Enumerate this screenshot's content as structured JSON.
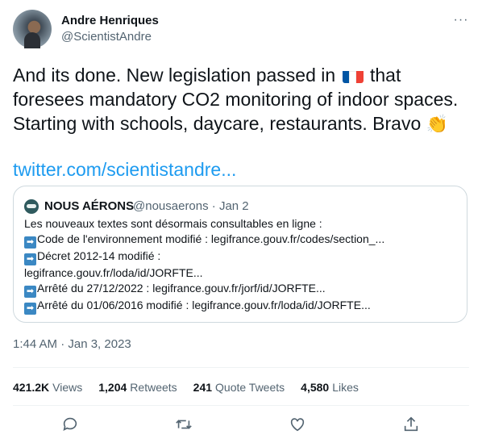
{
  "author": {
    "name": "Andre Henriques",
    "handle": "@ScientistAndre"
  },
  "more_label": "···",
  "tweet": {
    "line1_before": "And its done. New legislation passed in ",
    "line1_after": " that",
    "line2": "foresees mandatory CO2 monitoring of indoor spaces.",
    "line3_before": "Starting with schools, daycare, restaurants. Bravo ",
    "clap": "👏",
    "link": "twitter.com/scientistandre..."
  },
  "quote": {
    "name": "NOUS AÉRONS",
    "meta": "@nousaerons · Jan 2",
    "lines": [
      {
        "arrow": false,
        "text": "Les nouveaux textes sont désormais consultables en ligne :"
      },
      {
        "arrow": true,
        "text": "Code de l'environnement modifié : legifrance.gouv.fr/codes/section_..."
      },
      {
        "arrow": true,
        "text": "Décret 2012-14 modifié :"
      },
      {
        "arrow": false,
        "text": "legifrance.gouv.fr/loda/id/JORFTE..."
      },
      {
        "arrow": true,
        "text": "Arrêté du 27/12/2022 : legifrance.gouv.fr/jorf/id/JORFTE..."
      },
      {
        "arrow": true,
        "text": "Arrêté du 01/06/2016 modifié : legifrance.gouv.fr/loda/id/JORFTE..."
      }
    ],
    "arrow_glyph": "➡"
  },
  "timestamp": "1:44 AM · Jan 3, 2023",
  "stats": {
    "views": {
      "value": "421.2K",
      "label": "Views"
    },
    "retweets": {
      "value": "1,204",
      "label": "Retweets"
    },
    "quote_tweets": {
      "value": "241",
      "label": "Quote Tweets"
    },
    "likes": {
      "value": "4,580",
      "label": "Likes"
    }
  },
  "colors": {
    "link": "#1d9bf0",
    "secondary_text": "#536471",
    "border": "#cfd9de",
    "flag_blue": "#0055a4",
    "flag_white": "#ffffff",
    "flag_red": "#ef4135"
  },
  "icons": [
    "reply-icon",
    "retweet-icon",
    "like-icon",
    "share-icon"
  ]
}
